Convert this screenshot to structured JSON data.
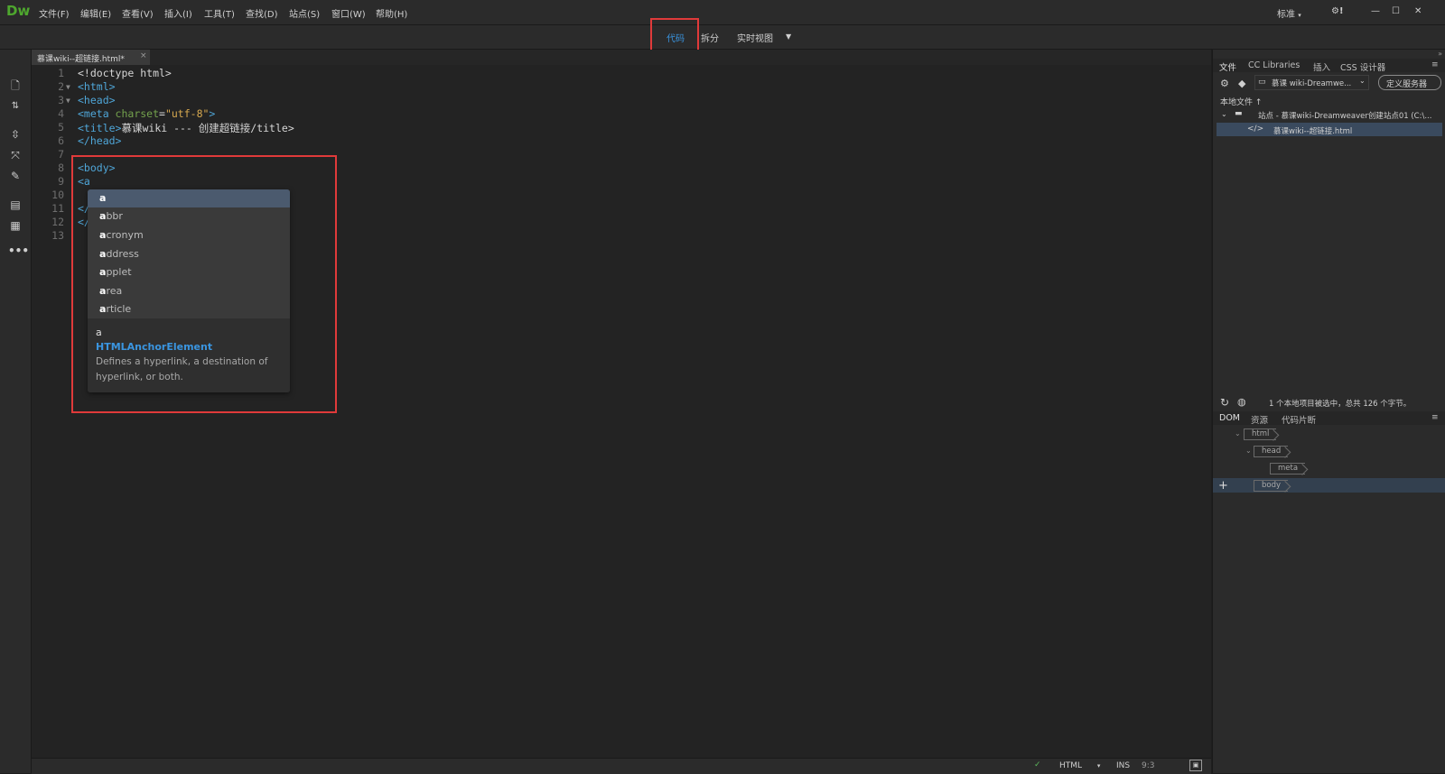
{
  "app": {
    "logo": "Dw"
  },
  "menu": [
    "文件(F)",
    "编辑(E)",
    "查看(V)",
    "插入(I)",
    "工具(T)",
    "查找(D)",
    "站点(S)",
    "窗口(W)",
    "帮助(H)"
  ],
  "workspace": {
    "layout_label": "标准",
    "settings_glyph": "⚙!"
  },
  "window_controls": {
    "minimize": "—",
    "maximize": "☐",
    "close": "✕"
  },
  "view_modes": {
    "code": "代码",
    "split": "拆分",
    "live": "实时视图"
  },
  "document_tab": {
    "label": "慕课wiki--超链接.html*",
    "close": "×"
  },
  "editor": {
    "lines": [
      {
        "n": "1",
        "fold": ""
      },
      {
        "n": "2",
        "fold": "▼"
      },
      {
        "n": "3",
        "fold": "▼"
      },
      {
        "n": "4",
        "fold": ""
      },
      {
        "n": "5",
        "fold": ""
      },
      {
        "n": "6",
        "fold": ""
      },
      {
        "n": "7",
        "fold": ""
      },
      {
        "n": "8",
        "fold": ""
      },
      {
        "n": "9",
        "fold": ""
      },
      {
        "n": "10",
        "fold": ""
      },
      {
        "n": "11",
        "fold": ""
      },
      {
        "n": "12",
        "fold": ""
      },
      {
        "n": "13",
        "fold": ""
      }
    ],
    "code": {
      "l1": "<!doctype html>",
      "l2": "<html>",
      "l3": "<head>",
      "l4_tag_open": "<meta ",
      "l4_attr": "charset",
      "l4_eq": "=",
      "l4_val": "\"utf-8\"",
      "l4_close": ">",
      "l5_tag": "<title>",
      "l5_text": "慕课wiki --- 创建超链接/title>",
      "l6": "</head>",
      "l8": "<body>",
      "l9": "<a",
      "l11": "</",
      "l12": "</"
    }
  },
  "autocomplete": {
    "items": [
      {
        "bold": "a",
        "rest": ""
      },
      {
        "bold": "a",
        "rest": "bbr"
      },
      {
        "bold": "a",
        "rest": "cronym"
      },
      {
        "bold": "a",
        "rest": "ddress"
      },
      {
        "bold": "a",
        "rest": "pplet"
      },
      {
        "bold": "a",
        "rest": "rea"
      },
      {
        "bold": "a",
        "rest": "rticle"
      }
    ],
    "detail": {
      "name": "a",
      "interface": "HTMLAnchorElement",
      "description_line1": "Defines a hyperlink, a destination of",
      "description_line2": "hyperlink, or both."
    }
  },
  "status": {
    "language": "HTML",
    "mode": "INS",
    "position": "9:3"
  },
  "files_panel": {
    "tabs": [
      "文件",
      "CC Libraries",
      "插入",
      "CSS 设计器"
    ],
    "site_select": "慕课 wiki-Dreamwe...",
    "define_server": "定义服务器",
    "local_files": "本地文件 ↑",
    "site_root": "站点 - 慕课wiki-Dreamweaver创建站点01 (C:\\...",
    "file": "慕课wiki--超链接.html",
    "status": "1 个本地项目被选中，总共 126 个字节。"
  },
  "dom_panel": {
    "tabs": [
      "DOM",
      "资源",
      "代码片断"
    ],
    "nodes": [
      "html",
      "head",
      "meta",
      "body"
    ],
    "add": "+"
  },
  "colors": {
    "accent": "#3a95e0",
    "highlight_box": "#e03a3a",
    "logo": "#4ea72e"
  }
}
